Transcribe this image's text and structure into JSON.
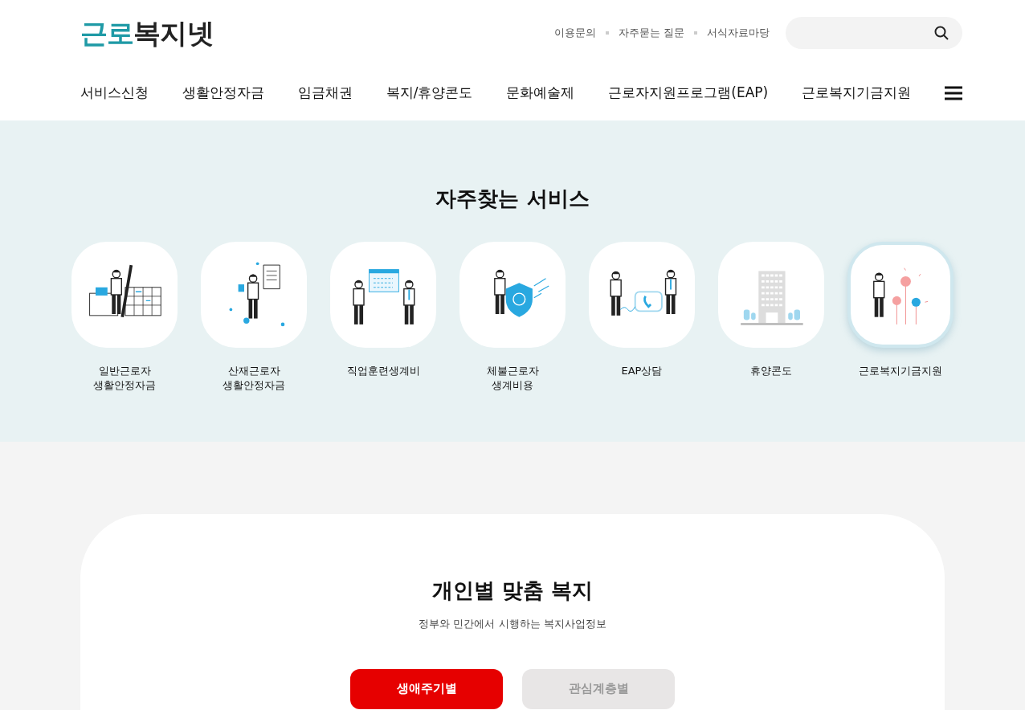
{
  "logo": {
    "accent": "근로",
    "rest": "복지넷"
  },
  "util_links": [
    "이용문의",
    "자주묻는 질문",
    "서식자료마당"
  ],
  "nav": [
    "서비스신청",
    "생활안정자금",
    "임금채권",
    "복지/휴양콘도",
    "문화예술제",
    "근로자지원프로그램(EAP)",
    "근로복지기금지원"
  ],
  "services": {
    "title": "자주찾는 서비스",
    "items": [
      {
        "kind": "calendar",
        "label": "일반근로자\n생활안정자금",
        "selected": false
      },
      {
        "kind": "document",
        "label": "산재근로자\n생활안정자금",
        "selected": false
      },
      {
        "kind": "presentation",
        "label": "직업훈련생계비",
        "selected": false
      },
      {
        "kind": "shield",
        "label": "체불근로자\n생계비용",
        "selected": false
      },
      {
        "kind": "phone",
        "label": "EAP상담",
        "selected": false
      },
      {
        "kind": "building",
        "label": "휴양콘도",
        "selected": false
      },
      {
        "kind": "flowers",
        "label": "근로복지기금지원",
        "selected": true
      }
    ]
  },
  "welfare": {
    "title": "개인별 맞춤 복지",
    "subtitle": "정부와 민간에서 시행하는 복지사업정보",
    "tabs": [
      {
        "label": "생애주기별",
        "selected": true
      },
      {
        "label": "관심계층별",
        "selected": false
      }
    ]
  }
}
